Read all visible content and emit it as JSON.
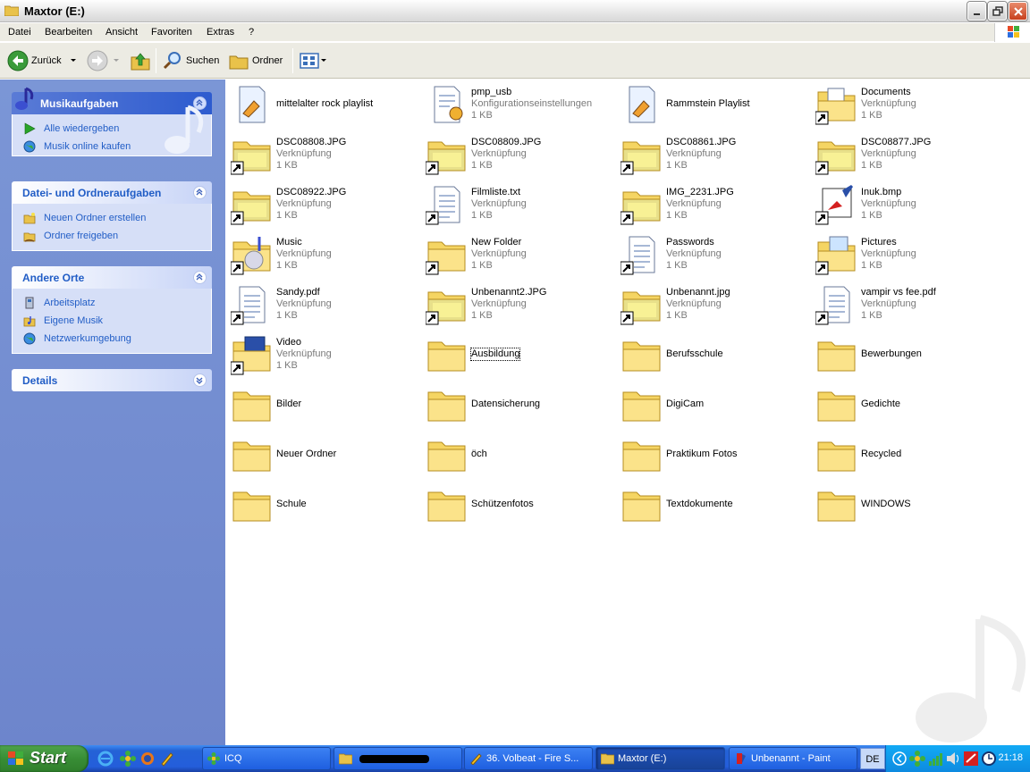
{
  "window": {
    "title": "Maxtor (E:)"
  },
  "menu": [
    "Datei",
    "Bearbeiten",
    "Ansicht",
    "Favoriten",
    "Extras",
    "?"
  ],
  "toolbar": {
    "back": "Zurück",
    "search": "Suchen",
    "folders": "Ordner"
  },
  "sidebar": {
    "music": {
      "title": "Musikaufgaben",
      "links": [
        "Alle wiedergeben",
        "Musik online kaufen"
      ]
    },
    "file_tasks": {
      "title": "Datei- und Ordneraufgaben",
      "links": [
        "Neuen Ordner erstellen",
        "Ordner freigeben"
      ]
    },
    "other_places": {
      "title": "Andere Orte",
      "links": [
        "Arbeitsplatz",
        "Eigene Musik",
        "Netzwerkumgebung"
      ]
    },
    "details": {
      "title": "Details"
    }
  },
  "items": [
    {
      "name": "mittelalter rock playlist",
      "type": "",
      "size": "",
      "icon": "playlist-icon"
    },
    {
      "name": "pmp_usb",
      "type": "Konfigurationseinstellungen",
      "size": "1 KB",
      "icon": "config-file-icon"
    },
    {
      "name": "Rammstein Playlist",
      "type": "",
      "size": "",
      "icon": "playlist-icon"
    },
    {
      "name": "Documents",
      "type": "Verknüpfung",
      "size": "1 KB",
      "icon": "documents-shortcut-icon"
    },
    {
      "name": "DSC08808.JPG",
      "type": "Verknüpfung",
      "size": "1 KB",
      "icon": "image-shortcut-icon"
    },
    {
      "name": "DSC08809.JPG",
      "type": "Verknüpfung",
      "size": "1 KB",
      "icon": "image-shortcut-icon"
    },
    {
      "name": "DSC08861.JPG",
      "type": "Verknüpfung",
      "size": "1 KB",
      "icon": "image-shortcut-icon"
    },
    {
      "name": "DSC08877.JPG",
      "type": "Verknüpfung",
      "size": "1 KB",
      "icon": "image-shortcut-icon"
    },
    {
      "name": "DSC08922.JPG",
      "type": "Verknüpfung",
      "size": "1 KB",
      "icon": "image-shortcut-icon"
    },
    {
      "name": "Filmliste.txt",
      "type": "Verknüpfung",
      "size": "1 KB",
      "icon": "text-shortcut-icon"
    },
    {
      "name": "IMG_2231.JPG",
      "type": "Verknüpfung",
      "size": "1 KB",
      "icon": "image-shortcut-icon"
    },
    {
      "name": "Inuk.bmp",
      "type": "Verknüpfung",
      "size": "1 KB",
      "icon": "paint-shortcut-icon"
    },
    {
      "name": "Music",
      "type": "Verknüpfung",
      "size": "1 KB",
      "icon": "music-folder-shortcut-icon"
    },
    {
      "name": "New Folder",
      "type": "Verknüpfung",
      "size": "1 KB",
      "icon": "folder-shortcut-icon"
    },
    {
      "name": "Passwords",
      "type": "Verknüpfung",
      "size": "1 KB",
      "icon": "text-shortcut-icon"
    },
    {
      "name": "Pictures",
      "type": "Verknüpfung",
      "size": "1 KB",
      "icon": "pictures-shortcut-icon"
    },
    {
      "name": "Sandy.pdf",
      "type": "Verknüpfung",
      "size": "1 KB",
      "icon": "text-shortcut-icon"
    },
    {
      "name": "Unbenannt2.JPG",
      "type": "Verknüpfung",
      "size": "1 KB",
      "icon": "image-shortcut-icon"
    },
    {
      "name": "Unbenannt.jpg",
      "type": "Verknüpfung",
      "size": "1 KB",
      "icon": "image-shortcut-icon"
    },
    {
      "name": "vampir vs fee.pdf",
      "type": "Verknüpfung",
      "size": "1 KB",
      "icon": "text-shortcut-icon"
    },
    {
      "name": "Video",
      "type": "Verknüpfung",
      "size": "1 KB",
      "icon": "video-folder-shortcut-icon"
    },
    {
      "name": "Ausbildung",
      "type": "",
      "size": "",
      "icon": "folder-icon",
      "selected": true
    },
    {
      "name": "Berufsschule",
      "type": "",
      "size": "",
      "icon": "folder-icon"
    },
    {
      "name": "Bewerbungen",
      "type": "",
      "size": "",
      "icon": "folder-icon"
    },
    {
      "name": "Bilder",
      "type": "",
      "size": "",
      "icon": "folder-icon"
    },
    {
      "name": "Datensicherung",
      "type": "",
      "size": "",
      "icon": "folder-icon"
    },
    {
      "name": "DigiCam",
      "type": "",
      "size": "",
      "icon": "folder-icon"
    },
    {
      "name": "Gedichte",
      "type": "",
      "size": "",
      "icon": "folder-icon"
    },
    {
      "name": "Neuer Ordner",
      "type": "",
      "size": "",
      "icon": "folder-icon"
    },
    {
      "name": "öch",
      "type": "",
      "size": "",
      "icon": "folder-icon"
    },
    {
      "name": "Praktikum Fotos",
      "type": "",
      "size": "",
      "icon": "folder-icon"
    },
    {
      "name": "Recycled",
      "type": "",
      "size": "",
      "icon": "folder-icon"
    },
    {
      "name": "Schule",
      "type": "",
      "size": "",
      "icon": "folder-icon"
    },
    {
      "name": "Schützenfotos",
      "type": "",
      "size": "",
      "icon": "folder-icon"
    },
    {
      "name": "Textdokumente",
      "type": "",
      "size": "",
      "icon": "folder-icon"
    },
    {
      "name": "WINDOWS",
      "type": "",
      "size": "",
      "icon": "folder-icon"
    }
  ],
  "taskbar": {
    "start": "Start",
    "tasks": [
      {
        "label": "ICQ",
        "icon": "icq-icon"
      },
      {
        "label": "",
        "icon": "folder-icon",
        "redacted": true
      },
      {
        "label": "36. Volbeat - Fire S...",
        "icon": "winamp-icon"
      },
      {
        "label": "Maxtor (E:)",
        "icon": "folder-icon",
        "active": true
      },
      {
        "label": "Unbenannt - Paint",
        "icon": "paint-icon"
      }
    ],
    "language": "DE",
    "clock": "21:18"
  }
}
